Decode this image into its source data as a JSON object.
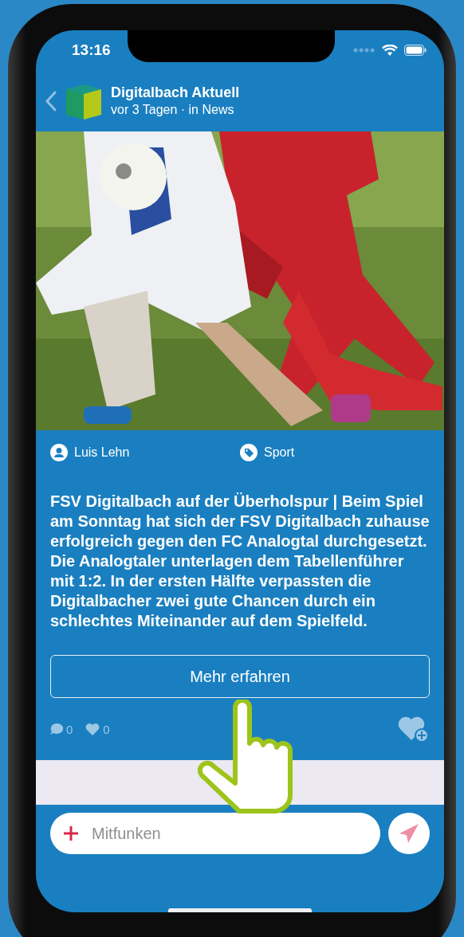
{
  "status_bar": {
    "time": "13:16"
  },
  "header": {
    "title": "Digitalbach Aktuell",
    "subtitle": "vor 3 Tagen · in News"
  },
  "post": {
    "author": "Luis Lehn",
    "category": "Sport",
    "text": "FSV Digitalbach auf der Überholspur | Beim Spiel am Sonntag hat sich der FSV Digitalbach zuhause erfolgreich gegen den FC Analogtal durchgesetzt. Die Analogtaler unterlagen dem Tabellenführer mit 1:2. In der ersten Hälfte verpassten die Digitalbacher zwei gute Chancen durch ein schlechtes Miteinander auf dem Spielfeld.",
    "button": "Mehr erfahren"
  },
  "stats": {
    "comments": "0",
    "likes": "0"
  },
  "composer": {
    "placeholder": "Mitfunken"
  }
}
